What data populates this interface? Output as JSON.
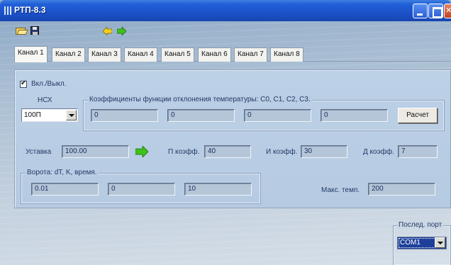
{
  "window": {
    "title": "РТП-8.3"
  },
  "toolbar": {
    "icons": [
      "open-folder-icon",
      "save-icon",
      "arrow-left-icon",
      "arrow-right-icon"
    ]
  },
  "tabs": [
    "Канал 1",
    "Канал 2",
    "Канал 3",
    "Канал 4",
    "Канал 5",
    "Канал 6",
    "Канал 7",
    "Канал 8"
  ],
  "active_tab": "Канал 1",
  "channel": {
    "enable_label": "Вкл./Выкл.",
    "enabled": true,
    "nsx_label": "НСХ",
    "nsx_value": "100П",
    "coeff_group_title": "Коэффициенты функции отклонения температуры: С0, С1, С2, С3.",
    "c0": "0",
    "c1": "0",
    "c2": "0",
    "c3": "0",
    "calc_button": "Расчет",
    "setpoint_label": "Уставка",
    "setpoint_value": "100.00",
    "p_label": "П коэфф.",
    "p_value": "40",
    "i_label": "И коэфф.",
    "i_value": "30",
    "d_label": "Д коэфф.",
    "d_value": "7",
    "gate_group_title": "Ворота: dT, K, время.",
    "gate_dt": "0.01",
    "gate_k": "0",
    "gate_time": "10",
    "max_temp_label": "Макс. темп.",
    "max_temp_value": "200"
  },
  "port": {
    "group_title": "Послед. порт",
    "value": "COM1"
  },
  "colors": {
    "titlebar": "#2160d8",
    "panel": "#b9cde4",
    "field": "#b5c6d9",
    "arrow_green": "#3fc21a",
    "arrow_yellow": "#f0d020"
  }
}
